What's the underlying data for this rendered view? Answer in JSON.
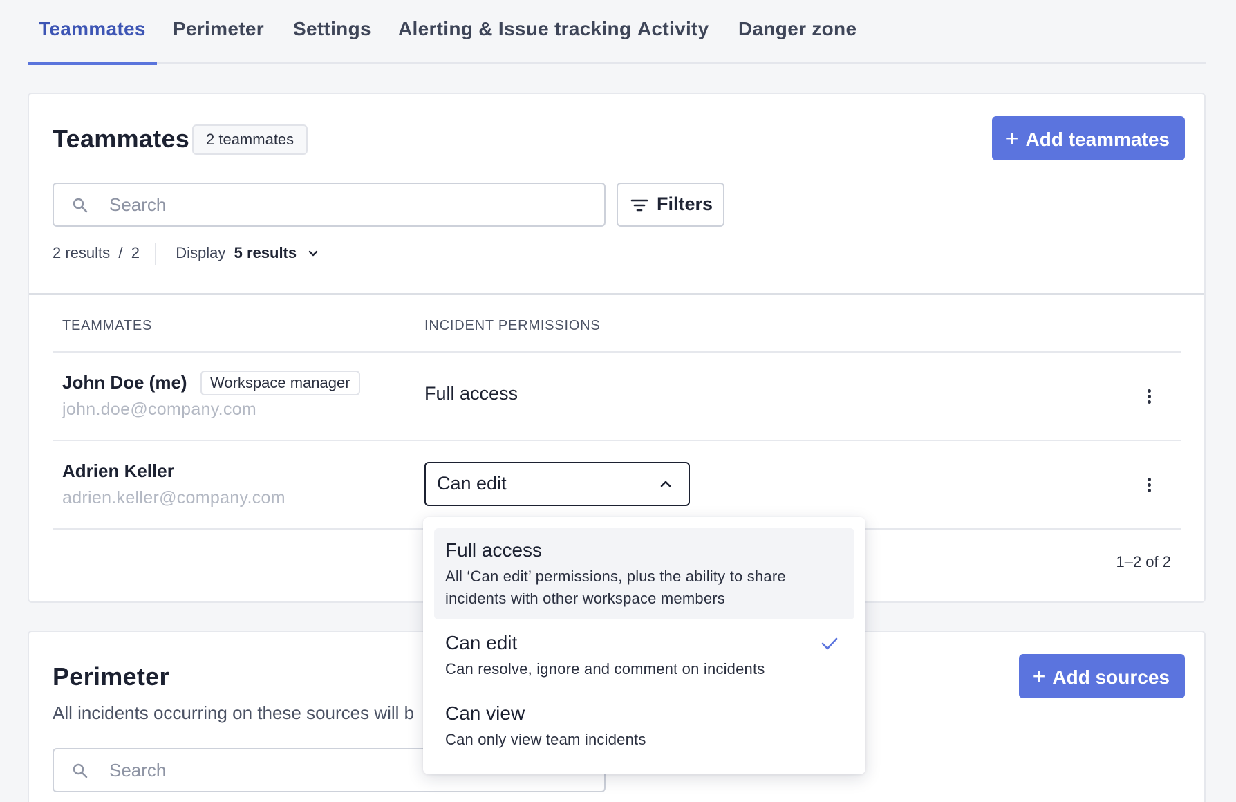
{
  "tabs": [
    {
      "label": "Teammates",
      "active": true
    },
    {
      "label": "Perimeter"
    },
    {
      "label": "Settings"
    },
    {
      "label": "Alerting & Issue tracking"
    },
    {
      "label": "Activity"
    },
    {
      "label": "Danger zone"
    }
  ],
  "teammates_card": {
    "title": "Teammates",
    "count_badge": "2 teammates",
    "add_button": "Add teammates",
    "search_placeholder": "Search",
    "filters_label": "Filters",
    "results_count": "2 results",
    "results_total": "2",
    "display_label": "Display",
    "display_value": "5 results",
    "columns": [
      "TEAMMATES",
      "INCIDENT PERMISSIONS"
    ],
    "rows": [
      {
        "name": "John Doe (me)",
        "role": "Workspace manager",
        "email": "john.doe@company.com",
        "permission": "Full access"
      },
      {
        "name": "Adrien Keller",
        "email": "adrien.keller@company.com",
        "permission": "Can edit"
      }
    ],
    "pagination": "1–2 of 2"
  },
  "permission_menu": {
    "options": [
      {
        "title": "Full access",
        "description_line1": "All ‘Can edit’ permissions, plus the ability to share",
        "description_line2": "incidents with other workspace members",
        "hovered": true
      },
      {
        "title": "Can edit",
        "description": "Can resolve, ignore and comment on incidents",
        "selected": true
      },
      {
        "title": "Can view",
        "description": "Can only view team incidents"
      }
    ]
  },
  "perimeter_card": {
    "title": "Perimeter",
    "description": "All incidents occurring on these sources will b",
    "add_button": "Add sources",
    "search_placeholder": "Search"
  },
  "colors": {
    "accent": "#5b74de",
    "active_tab": "#3d55b4",
    "check": "#5b74de"
  },
  "icons": [
    "search-icon",
    "filter-icon",
    "chevron-down-icon",
    "chevron-up-icon",
    "kebab-icon",
    "plus-icon",
    "check-icon"
  ]
}
